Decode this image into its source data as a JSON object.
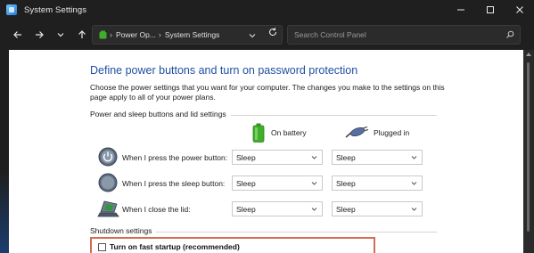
{
  "window": {
    "title": "System Settings"
  },
  "breadcrumb": {
    "items": [
      "Power Op...",
      "System Settings"
    ]
  },
  "search": {
    "placeholder": "Search Control Panel"
  },
  "page": {
    "heading": "Define power buttons and turn on password protection",
    "description": "Choose the power settings that you want for your computer. The changes you make to the settings on this page apply to all of your power plans."
  },
  "power_group": {
    "label": "Power and sleep buttons and lid settings",
    "columns": {
      "battery": "On battery",
      "plugged": "Plugged in"
    },
    "rows": [
      {
        "label": "When I press the power button:",
        "battery": "Sleep",
        "plugged": "Sleep",
        "icon": "power-button-icon"
      },
      {
        "label": "When I press the sleep button:",
        "battery": "Sleep",
        "plugged": "Sleep",
        "icon": "sleep-button-icon"
      },
      {
        "label": "When I close the lid:",
        "battery": "Sleep",
        "plugged": "Sleep",
        "icon": "laptop-lid-icon"
      }
    ]
  },
  "shutdown_group": {
    "label": "Shutdown settings",
    "fast_startup": {
      "label": "Turn on fast startup (recommended)",
      "checked": false
    }
  },
  "colors": {
    "heading": "#1e4f9e",
    "highlight": "#d56b52",
    "battery": "#3fae2a"
  }
}
